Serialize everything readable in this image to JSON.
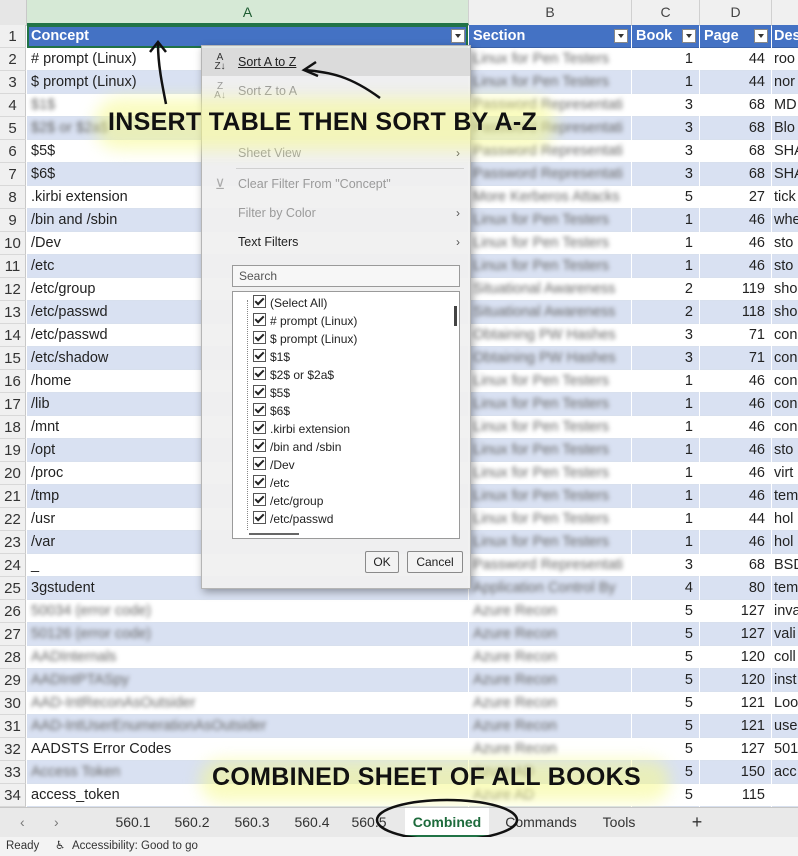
{
  "columns": [
    {
      "letter": "A"
    },
    {
      "letter": "B"
    },
    {
      "letter": "C"
    },
    {
      "letter": "D"
    },
    {
      "letter": ""
    }
  ],
  "header_row": {
    "num": "1",
    "concept": "Concept",
    "section": "Section",
    "book": "Book",
    "page": "Page",
    "desc": "Des"
  },
  "rows": [
    {
      "num": "2",
      "concept": "# prompt (Linux)",
      "section": "Linux for Pen Testers",
      "book": "1",
      "page": "44",
      "desc": "roo"
    },
    {
      "num": "3",
      "concept": "$ prompt (Linux)",
      "section": "Linux for Pen Testers",
      "book": "1",
      "page": "44",
      "desc": "nor"
    },
    {
      "num": "4",
      "concept": "$1$",
      "section": "Password Representati",
      "book": "3",
      "page": "68",
      "desc": "MD"
    },
    {
      "num": "5",
      "concept": "$2$ or $2a$",
      "section": "Password Representati",
      "book": "3",
      "page": "68",
      "desc": "Blo"
    },
    {
      "num": "6",
      "concept": "$5$",
      "section": "Password Representati",
      "book": "3",
      "page": "68",
      "desc": "SHA"
    },
    {
      "num": "7",
      "concept": "$6$",
      "section": "Password Representati",
      "book": "3",
      "page": "68",
      "desc": "SHA"
    },
    {
      "num": "8",
      "concept": ".kirbi extension",
      "section": "More Kerberos Attacks",
      "book": "5",
      "page": "27",
      "desc": "tick"
    },
    {
      "num": "9",
      "concept": "/bin and /sbin",
      "section": "Linux for Pen Testers",
      "book": "1",
      "page": "46",
      "desc": "whe"
    },
    {
      "num": "10",
      "concept": "/Dev",
      "section": "Linux for Pen Testers",
      "book": "1",
      "page": "46",
      "desc": "sto"
    },
    {
      "num": "11",
      "concept": "/etc",
      "section": "Linux for Pen Testers",
      "book": "1",
      "page": "46",
      "desc": "sto"
    },
    {
      "num": "12",
      "concept": "/etc/group",
      "section": "Situational Awareness",
      "book": "2",
      "page": "119",
      "desc": "sho"
    },
    {
      "num": "13",
      "concept": "/etc/passwd",
      "section": "Situational Awareness",
      "book": "2",
      "page": "118",
      "desc": "sho"
    },
    {
      "num": "14",
      "concept": "/etc/passwd",
      "section": "Obtaining PW Hashes",
      "book": "3",
      "page": "71",
      "desc": "con"
    },
    {
      "num": "15",
      "concept": "/etc/shadow",
      "section": "Obtaining PW Hashes",
      "book": "3",
      "page": "71",
      "desc": "con"
    },
    {
      "num": "16",
      "concept": "/home",
      "section": "Linux for Pen Testers",
      "book": "1",
      "page": "46",
      "desc": "con"
    },
    {
      "num": "17",
      "concept": "/lib",
      "section": "Linux for Pen Testers",
      "book": "1",
      "page": "46",
      "desc": "con"
    },
    {
      "num": "18",
      "concept": "/mnt",
      "section": "Linux for Pen Testers",
      "book": "1",
      "page": "46",
      "desc": "con"
    },
    {
      "num": "19",
      "concept": "/opt",
      "section": "Linux for Pen Testers",
      "book": "1",
      "page": "46",
      "desc": "sto"
    },
    {
      "num": "20",
      "concept": "/proc",
      "section": "Linux for Pen Testers",
      "book": "1",
      "page": "46",
      "desc": "virt"
    },
    {
      "num": "21",
      "concept": "/tmp",
      "section": "Linux for Pen Testers",
      "book": "1",
      "page": "46",
      "desc": "tem"
    },
    {
      "num": "22",
      "concept": "/usr",
      "section": "Linux for Pen Testers",
      "book": "1",
      "page": "44",
      "desc": "hol"
    },
    {
      "num": "23",
      "concept": "/var",
      "section": "Linux for Pen Testers",
      "book": "1",
      "page": "46",
      "desc": "hol"
    },
    {
      "num": "24",
      "concept": "_",
      "section": "Password Representati",
      "book": "3",
      "page": "68",
      "desc": "BSD"
    },
    {
      "num": "25",
      "concept": "3gstudent",
      "section": "Application Control By",
      "book": "4",
      "page": "80",
      "desc": "tem"
    },
    {
      "num": "26",
      "concept": "50034 (error code)",
      "section": "Azure Recon",
      "book": "5",
      "page": "127",
      "desc": "inva"
    },
    {
      "num": "27",
      "concept": "50126 (error code)",
      "section": "Azure Recon",
      "book": "5",
      "page": "127",
      "desc": "vali"
    },
    {
      "num": "28",
      "concept": "AADInternals",
      "section": "Azure Recon",
      "book": "5",
      "page": "120",
      "desc": "coll"
    },
    {
      "num": "29",
      "concept": "AADIntPTASpy",
      "section": "Azure Recon",
      "book": "5",
      "page": "120",
      "desc": "inst"
    },
    {
      "num": "30",
      "concept": "AAD-IntReconAsOutsider",
      "section": "Azure Recon",
      "book": "5",
      "page": "121",
      "desc": "Loo"
    },
    {
      "num": "31",
      "concept": "AAD-IntUserEnumerationAsOutsider",
      "section": "Azure Recon",
      "book": "5",
      "page": "121",
      "desc": "use"
    },
    {
      "num": "32",
      "concept": "AADSTS Error Codes",
      "section": "Azure Recon",
      "book": "5",
      "page": "127",
      "desc": "501"
    },
    {
      "num": "33",
      "concept": "Access Token",
      "section": "Azure AD",
      "book": "5",
      "page": "150",
      "desc": "acc"
    },
    {
      "num": "34",
      "concept": "access_token",
      "section": "Azure AD",
      "book": "5",
      "page": "115",
      "desc": ""
    }
  ],
  "filter_menu": {
    "sort_az": "Sort A to Z",
    "sort_za": "Sort Z to A",
    "sheet_view": "Sheet View",
    "clear_filter": "Clear Filter From \"Concept\"",
    "filter_by_color": "Filter by Color",
    "text_filters": "Text Filters",
    "search_placeholder": "Search",
    "items": [
      "(Select All)",
      "# prompt (Linux)",
      "$ prompt (Linux)",
      "$1$",
      "$2$ or $2a$",
      "$5$",
      "$6$",
      ".kirbi extension",
      "/bin and /sbin",
      "/Dev",
      "/etc",
      "/etc/group",
      "/etc/passwd"
    ],
    "ok": "OK",
    "cancel": "Cancel"
  },
  "annotations": {
    "top": "INSERT TABLE THEN SORT BY A-Z",
    "bottom": "COMBINED SHEET OF ALL BOOKS"
  },
  "sheet_tabs": [
    "560.1",
    "560.2",
    "560.3",
    "560.4",
    "560.5",
    "Combined",
    "Commands",
    "Tools"
  ],
  "active_tab": "Combined",
  "add_sheet": "+",
  "status": {
    "ready": "Ready",
    "accessibility": "Accessibility: Good to go"
  },
  "colors": {
    "header_blue": "#4472c4",
    "band_blue": "#d9e1f2",
    "excel_green": "#217346"
  }
}
